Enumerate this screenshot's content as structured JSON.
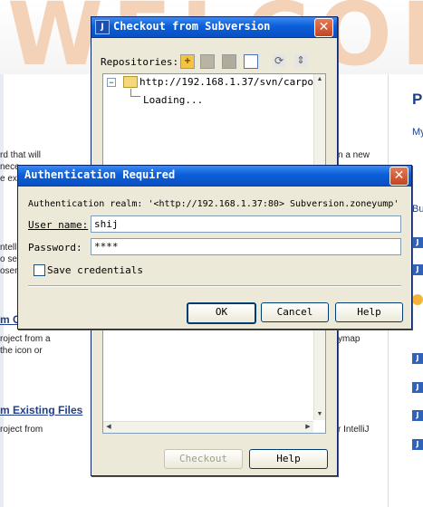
{
  "background": {
    "banner_text": "WELCOME",
    "left_lines": [
      "rd that will",
      "nece",
      "e ex"
    ],
    "left_lines2": [
      "ntell",
      "o se",
      "oser"
    ],
    "link1": "m Co",
    "left_lines3": [
      "roject from a",
      "the icon or"
    ],
    "link2": "m Existing Files",
    "left_line4": "roject from",
    "mid_right1": "n a new",
    "mid_right2": "ymap",
    "mid_right3": "r IntelliJ",
    "right_heading": "P",
    "right_sub": "My",
    "right_bu": "Bu"
  },
  "checkout": {
    "title": "Checkout from Subversion",
    "repositories_label": "Repositories:",
    "tree": {
      "repo_url": "http://192.168.1.37/svn/carpo",
      "loading": "Loading..."
    },
    "checkout_button": "Checkout",
    "help_button": "Help"
  },
  "auth": {
    "title": "Authentication Required",
    "realm": "Authentication realm: '<http://192.168.1.37:80> Subversion.zoneyump'",
    "username_label": "User name:",
    "username_value": "shij",
    "password_label": "Password:",
    "password_value": "****",
    "save_label": "Save credentials",
    "save_checked": false,
    "ok_button": "OK",
    "cancel_button": "Cancel",
    "help_button": "Help"
  }
}
